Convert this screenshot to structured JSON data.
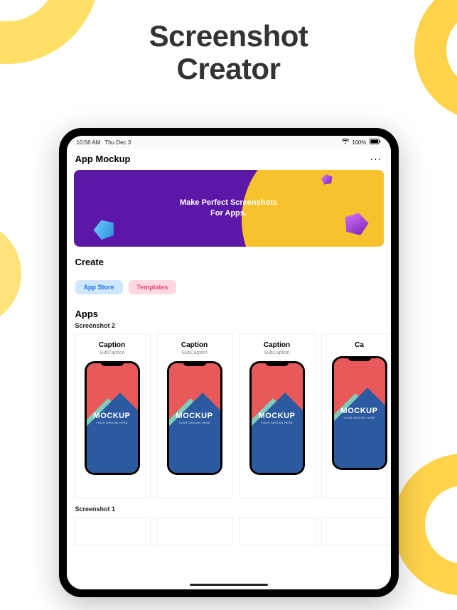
{
  "page_title_line1": "Screenshot",
  "page_title_line2": "Creator",
  "statusbar": {
    "time": "10:56 AM",
    "date": "Thu Dec 3",
    "battery": "100%"
  },
  "nav": {
    "title": "App Mockup",
    "more": "···"
  },
  "hero": {
    "line1": "Make Perfect Screenshots",
    "line2": "For Apps."
  },
  "create_title": "Create",
  "chips": {
    "app_store": "App Store",
    "templates": "Templates"
  },
  "apps_title": "Apps",
  "group2_title": "Screenshot 2",
  "group1_title": "Screenshot 1",
  "cards": [
    {
      "caption": "Caption",
      "sub": "SubCaption"
    },
    {
      "caption": "Caption",
      "sub": "SubCaption"
    },
    {
      "caption": "Caption",
      "sub": "SubCaption"
    },
    {
      "caption": "Ca",
      "sub": ""
    }
  ],
  "mockup": {
    "word": "MOCKUP",
    "tag": "YOUR DESIGN HERE"
  }
}
